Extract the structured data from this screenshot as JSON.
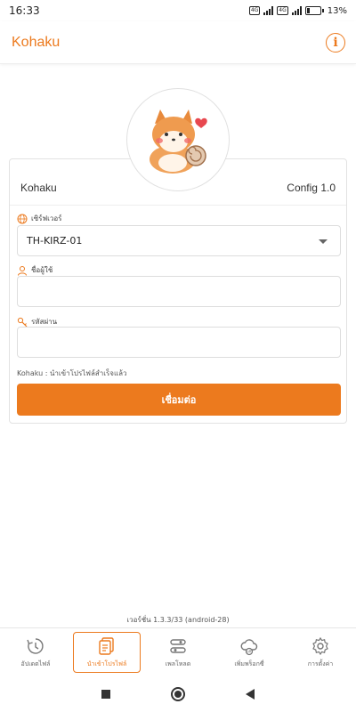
{
  "status_bar": {
    "time": "16:33",
    "battery_percent": "13%",
    "net_speed": "0.00 K/s"
  },
  "app_bar": {
    "title": "Kohaku",
    "info_icon": "info-icon"
  },
  "card": {
    "profile_name": "Kohaku",
    "config_label": "Config 1.0",
    "server_label": "เซิร์ฟเวอร์",
    "server_value": "TH-KIRZ-01",
    "username_label": "ชื่อผู้ใช้",
    "username_value": "",
    "password_label": "รหัสผ่าน",
    "password_value": "",
    "status_message": "Kohaku : นำเข้าโปรไฟล์สำเร็จแล้ว",
    "connect_label": "เชื่อมต่อ"
  },
  "version_text": "เวอร์ชั่น  1.3.3/33 (android-28)",
  "bottom_nav": [
    {
      "label": "อัปเดตไฟล์",
      "icon": "update-icon",
      "active": false
    },
    {
      "label": "นำเข้าโปรไฟล์",
      "icon": "import-profile-icon",
      "active": true
    },
    {
      "label": "เพลโหลด",
      "icon": "payload-icon",
      "active": false
    },
    {
      "label": "เพิ่มพร็อกซี่",
      "icon": "add-proxy-icon",
      "active": false
    },
    {
      "label": "การตั้งค่า",
      "icon": "settings-gear-icon",
      "active": false
    }
  ],
  "colors": {
    "accent": "#ec7a1e",
    "border": "#e2e2e2"
  }
}
